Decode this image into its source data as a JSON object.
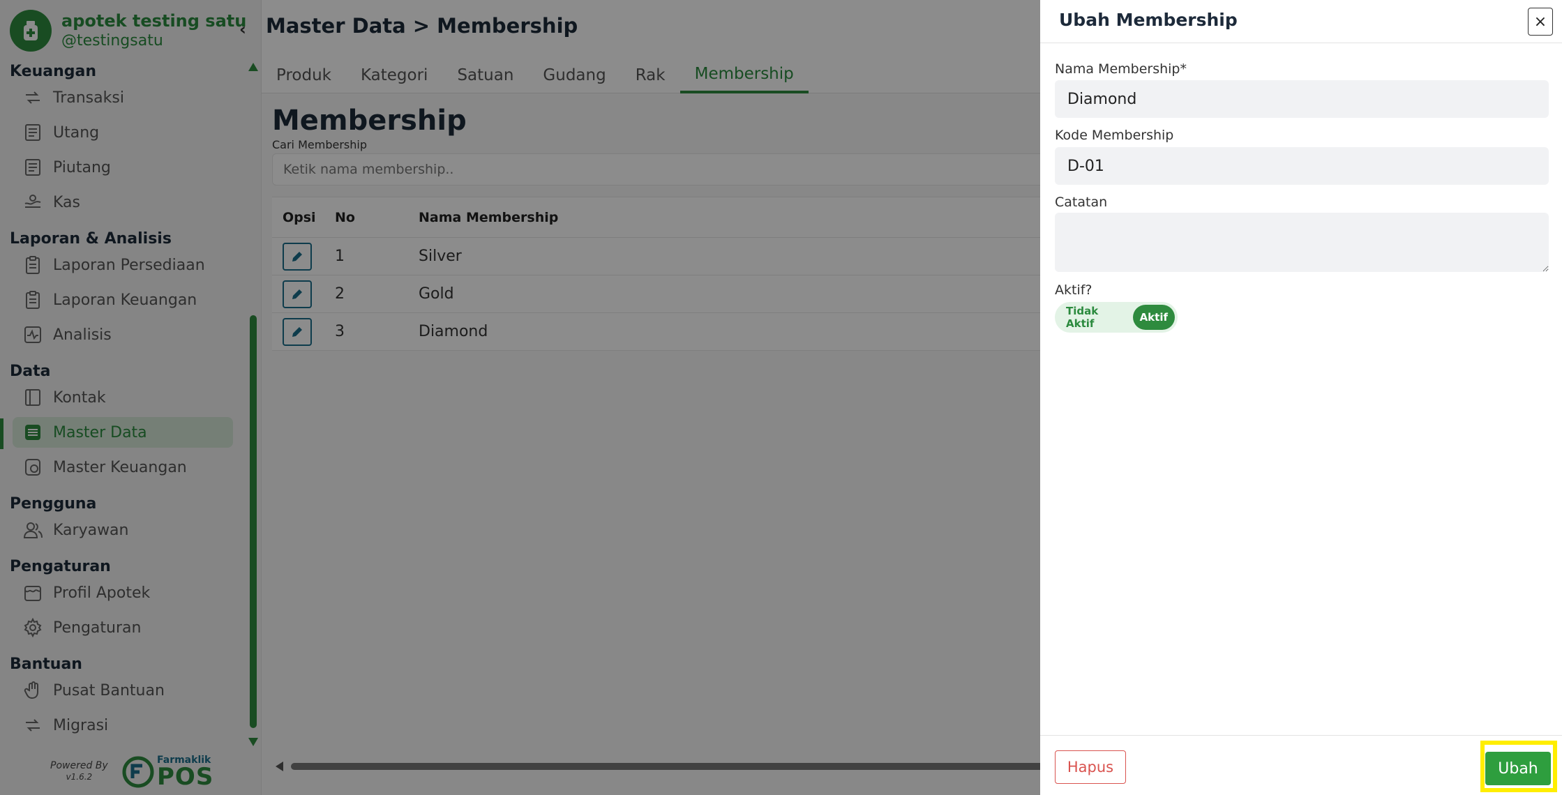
{
  "brand": {
    "name": "apotek testing satu",
    "handle": "@testingsatu"
  },
  "sidebar": {
    "sections": [
      {
        "title": "Keuangan",
        "items": [
          {
            "label": "Transaksi",
            "icon": "transaction-icon"
          },
          {
            "label": "Utang",
            "icon": "document-icon"
          },
          {
            "label": "Piutang",
            "icon": "document-icon"
          },
          {
            "label": "Kas",
            "icon": "cash-icon"
          }
        ]
      },
      {
        "title": "Laporan & Analisis",
        "items": [
          {
            "label": "Laporan Persediaan",
            "icon": "clipboard-icon"
          },
          {
            "label": "Laporan Keuangan",
            "icon": "clipboard-icon"
          },
          {
            "label": "Analisis",
            "icon": "chart-icon"
          }
        ]
      },
      {
        "title": "Data",
        "items": [
          {
            "label": "Kontak",
            "icon": "contact-book-icon"
          },
          {
            "label": "Master Data",
            "icon": "database-icon",
            "active": true
          },
          {
            "label": "Master Keuangan",
            "icon": "finance-icon"
          }
        ]
      },
      {
        "title": "Pengguna",
        "items": [
          {
            "label": "Karyawan",
            "icon": "users-icon"
          }
        ]
      },
      {
        "title": "Pengaturan",
        "items": [
          {
            "label": "Profil Apotek",
            "icon": "store-icon"
          },
          {
            "label": "Pengaturan",
            "icon": "gear-icon"
          }
        ]
      },
      {
        "title": "Bantuan",
        "items": [
          {
            "label": "Pusat Bantuan",
            "icon": "hand-icon"
          },
          {
            "label": "Migrasi",
            "icon": "migrate-icon"
          }
        ]
      }
    ],
    "powered_by": "Powered By",
    "version": "v1.6.2",
    "vendor_small": "Farmaklik",
    "vendor_big": "POS"
  },
  "header": {
    "title": "Master Data > Membership"
  },
  "tabs": [
    "Produk",
    "Kategori",
    "Satuan",
    "Gudang",
    "Rak",
    "Membership"
  ],
  "active_tab": "Membership",
  "main": {
    "section_title": "Membership",
    "search_label": "Cari Membership",
    "search_placeholder": "Ketik nama membership..",
    "columns": [
      "Opsi",
      "No",
      "Nama Membership"
    ],
    "rows": [
      {
        "no": "1",
        "name": "Silver"
      },
      {
        "no": "2",
        "name": "Gold"
      },
      {
        "no": "3",
        "name": "Diamond"
      }
    ]
  },
  "drawer": {
    "title": "Ubah Membership",
    "close": "×",
    "name_label": "Nama Membership*",
    "name_value": "Diamond",
    "code_label": "Kode Membership",
    "code_value": "D-01",
    "notes_label": "Catatan",
    "notes_value": "",
    "active_label": "Aktif?",
    "toggle_off": "Tidak Aktif",
    "toggle_on": "Aktif",
    "delete_button": "Hapus",
    "submit_button": "Ubah"
  },
  "colors": {
    "brand_green": "#2e8b3e",
    "danger": "#d9534f",
    "highlight": "#ffee00"
  }
}
